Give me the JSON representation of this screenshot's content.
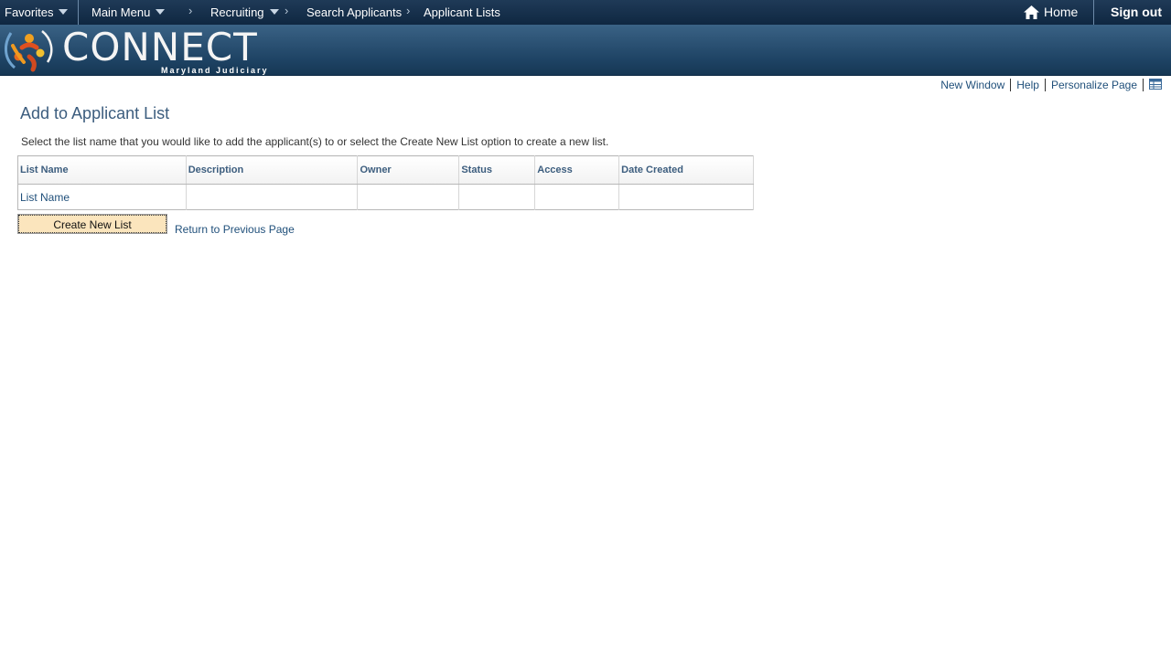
{
  "topnav": {
    "favorites": "Favorites",
    "main_menu": "Main Menu",
    "breadcrumbs": [
      "Recruiting",
      "Search Applicants",
      "Applicant Lists"
    ],
    "home": "Home",
    "sign_out": "Sign out"
  },
  "banner": {
    "logo_text": "CONNECT",
    "logo_subtext": "Maryland Judiciary"
  },
  "page_links": {
    "new_window": "New Window",
    "help": "Help",
    "personalize": "Personalize Page"
  },
  "page": {
    "title": "Add to Applicant List",
    "instructions": "Select the list name that you would like to add the applicant(s) to or select the Create New List option to create a new list."
  },
  "table": {
    "headers": [
      "List Name",
      "Description",
      "Owner",
      "Status",
      "Access",
      "Date Created"
    ],
    "rows": [
      [
        "List Name",
        "",
        "",
        "",
        "",
        ""
      ]
    ]
  },
  "actions": {
    "create_new_list": "Create New List",
    "return_previous": "Return to Previous Page"
  },
  "colors": {
    "nav_bg": "#0f2741",
    "banner_bg": "#1e4364",
    "link": "#1f4f7a",
    "title": "#3c5d7e",
    "button_bg": "#fbe5bd"
  }
}
